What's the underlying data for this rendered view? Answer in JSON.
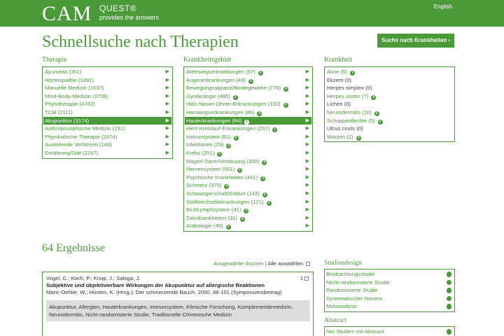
{
  "header": {
    "logo_cam": "CAM",
    "logo_quest": "QUEST®",
    "logo_sub": "provides the answers",
    "language": "English"
  },
  "page_title": "Schnellsuche nach Therapien",
  "disease_button": {
    "label": "Suche nach Krankheiten",
    "arrow": "›"
  },
  "therapie": {
    "title": "Therapie",
    "items": [
      "Ayurveda (351)",
      "Homöopathie (1891)",
      "Manuelle Medizin (1637)",
      "Mind-Body-Medizin (3708)",
      "Phytotherapie (4782)",
      "TCM (2111)",
      "Akupunktur (3174)",
      "Anthroposophische Medizin (191)",
      "Physikalische Therapie (2074)",
      "Ausleitende Verfahren (148)",
      "Ernährung/Diät (2257)"
    ],
    "selected_index": 6
  },
  "krankheitsgebiet": {
    "title": "Krankheitsgebiet",
    "items": [
      "Atemwegserkrankungen (97)",
      "Augenerkrankungen (49)",
      "Bewegungsapparat/Bindegewebe (778)",
      "Gynäkologie (486)",
      "Hals-Nasen-Ohren-Erkrankungen (102)",
      "Harnwegserkrankungen (86)",
      "Hauterkrankungen (64)",
      "Herz-Kreislauf-Erkrankungen (257)",
      "Immunsystem (81)",
      "Infektionen (29)",
      "Krebs (251)",
      "Magen-Darm/Verdauung (300)",
      "Nervensystem (501)",
      "Psychische Krankheiten (441)",
      "Schmerz (375)",
      "Schwangerschaft/Geburt (143)",
      "Stoffwechselerkrankungen (121)",
      "Blut/Lymphsystem (41)",
      "Zahnkrankheiten (31)",
      "Andrologie (45)"
    ],
    "selected_index": 6
  },
  "krankheit": {
    "title": "Krankheit",
    "items": [
      {
        "label": "Akne (6)",
        "info": true
      },
      {
        "label": "Ekzem (0)",
        "info": false
      },
      {
        "label": "Herpes simplex (0)",
        "info": false
      },
      {
        "label": "Herpes zoster (7)",
        "info": true
      },
      {
        "label": "Lichen (0)",
        "info": false
      },
      {
        "label": "Neurodermitis (10)",
        "info": true
      },
      {
        "label": "Schuppenflechte (5)",
        "info": true
      },
      {
        "label": "Ulcus cruris (0)",
        "info": false
      },
      {
        "label": "Warzen (2)",
        "info": true
      }
    ]
  },
  "info_glyph": "i",
  "list_arrow": "▶",
  "results": {
    "title": "64 Ergebnisse",
    "print_link": "Ausgewählte drucken",
    "separator": " | ",
    "select_all": "Alle auswählen:",
    "items": [
      {
        "number": "1",
        "authors": "Vogel, C.; Koch, P.; Knop, J.; Saloga, J.",
        "title": "Subjektive und objektivierbare Wirkungen der Akupunktur auf allergische Reaktionen",
        "source": "Maric-Oehler, W.; Hünten, K. (Hrsg.): Der schmerzende Bauch, 2000, 88-101 (Symposiumsbeitrag)",
        "tags": "Akupunktur, Allergien, Hauterkrankungen, Immunsystem, Klinische Forschung, Komplementärmedizin, Neurodermitis, Nicht-randomisierte Studie, Traditionelle Chinesische Medizin"
      }
    ]
  },
  "studiendesign": {
    "title": "Studiendesign",
    "items": [
      "Beobachtungsstudie",
      "Nicht-randomisierte Studie",
      "Randomisierte Studie",
      "Systematischer Review",
      "Metaanalyse"
    ]
  },
  "abstract": {
    "title": "Abstract",
    "items": [
      "Nur Studien mit Abstract"
    ]
  },
  "colors": {
    "brand_green": "#4a9a3a",
    "tag_bg": "#dddddd"
  }
}
